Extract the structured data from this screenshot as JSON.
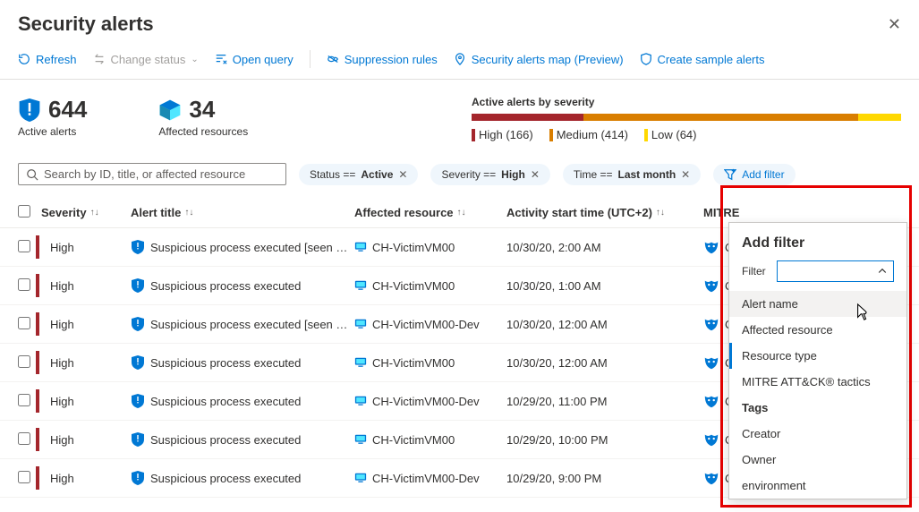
{
  "header": {
    "title": "Security alerts"
  },
  "toolbar": {
    "refresh": "Refresh",
    "change_status": "Change status",
    "open_query": "Open query",
    "suppression_rules": "Suppression rules",
    "alerts_map": "Security alerts map (Preview)",
    "create_sample": "Create sample alerts"
  },
  "stats": {
    "active_count": "644",
    "active_label": "Active alerts",
    "affected_count": "34",
    "affected_label": "Affected resources",
    "severity_title": "Active alerts by severity",
    "high": "High (166)",
    "medium": "Medium (414)",
    "low": "Low (64)"
  },
  "search_placeholder": "Search by ID, title, or affected resource",
  "filters": [
    {
      "label": "Status == ",
      "val": "Active"
    },
    {
      "label": "Severity == ",
      "val": "High"
    },
    {
      "label": "Time == ",
      "val": "Last month"
    }
  ],
  "add_filter": "Add filter",
  "columns": {
    "severity": "Severity",
    "title": "Alert title",
    "resource": "Affected resource",
    "time": "Activity start time (UTC+2)",
    "mitre": "MITRE"
  },
  "rows": [
    {
      "sev": "High",
      "title": "Suspicious process executed [seen …",
      "res": "CH-VictimVM00",
      "time": "10/30/20, 2:00 AM",
      "mitre": "C"
    },
    {
      "sev": "High",
      "title": "Suspicious process executed",
      "res": "CH-VictimVM00",
      "time": "10/30/20, 1:00 AM",
      "mitre": "C"
    },
    {
      "sev": "High",
      "title": "Suspicious process executed [seen …",
      "res": "CH-VictimVM00-Dev",
      "time": "10/30/20, 12:00 AM",
      "mitre": "C"
    },
    {
      "sev": "High",
      "title": "Suspicious process executed",
      "res": "CH-VictimVM00",
      "time": "10/30/20, 12:00 AM",
      "mitre": "Cre"
    },
    {
      "sev": "High",
      "title": "Suspicious process executed",
      "res": "CH-VictimVM00-Dev",
      "time": "10/29/20, 11:00 PM",
      "mitre": "Cre"
    },
    {
      "sev": "High",
      "title": "Suspicious process executed",
      "res": "CH-VictimVM00",
      "time": "10/29/20, 10:00 PM",
      "mitre": "Cre"
    },
    {
      "sev": "High",
      "title": "Suspicious process executed",
      "res": "CH-VictimVM00-Dev",
      "time": "10/29/20, 9:00 PM",
      "mitre": "Cre"
    }
  ],
  "popup": {
    "title": "Add filter",
    "filter_label": "Filter",
    "options": [
      "Alert name",
      "Affected resource",
      "Resource type",
      "MITRE ATT&CK® tactics",
      "Tags",
      "Creator",
      "Owner",
      "environment"
    ]
  }
}
